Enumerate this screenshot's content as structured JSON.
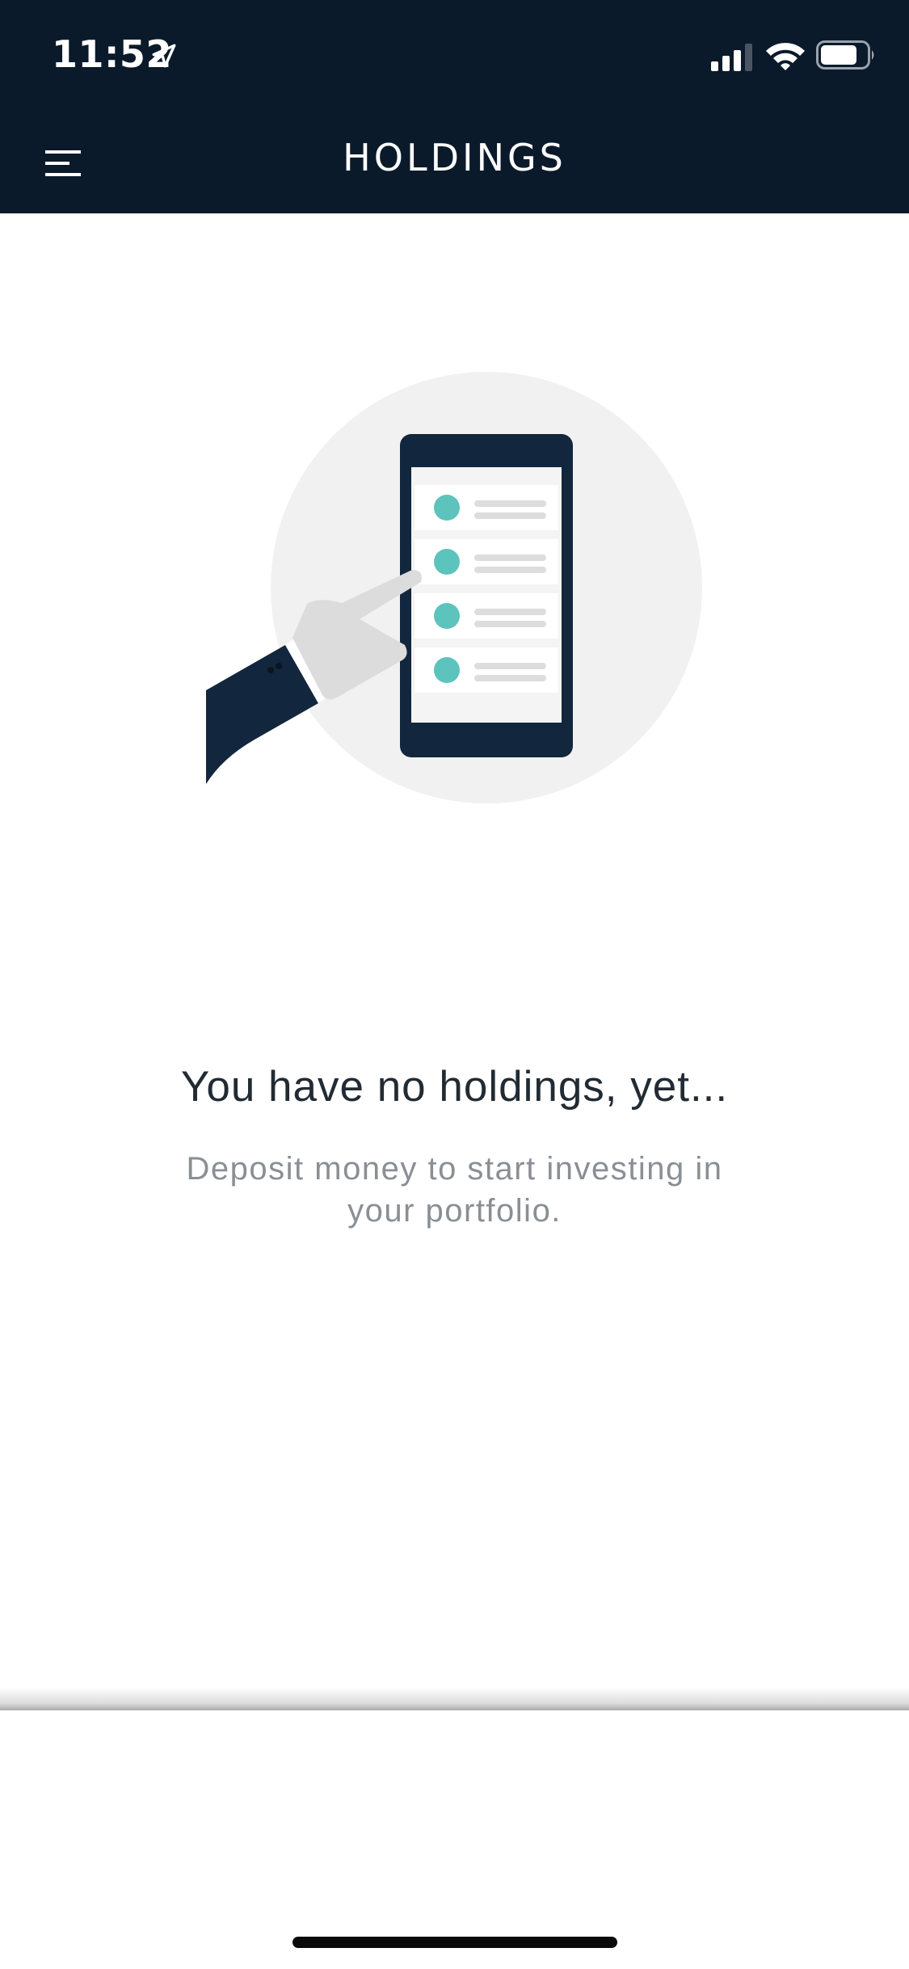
{
  "status_bar": {
    "time": "11:52"
  },
  "header": {
    "title": "HOLDINGS",
    "background_color": "#0b1a2b"
  },
  "icons": {
    "menu": "hamburger-menu-icon",
    "location": "location-arrow-icon",
    "signal": "cellular-signal-icon",
    "wifi": "wifi-icon",
    "battery": "battery-icon"
  },
  "empty_state": {
    "title": "You have no holdings, yet...",
    "subtitle": "Deposit money to start investing in your portfolio.",
    "illustration": "hand-tapping-phone-list-illustration",
    "accent_color": "#5cc3bd",
    "dark_color": "#12263d"
  }
}
